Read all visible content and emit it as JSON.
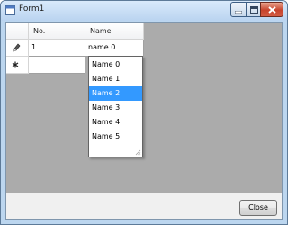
{
  "window": {
    "title": "Form1"
  },
  "grid": {
    "columns": [
      "No.",
      "Name"
    ],
    "rows": [
      {
        "no": "1",
        "name": "name 0",
        "state": "editing"
      },
      {
        "no": "",
        "name": "",
        "state": "new-row"
      }
    ]
  },
  "dropdown": {
    "options": [
      "Name 0",
      "Name 1",
      "Name 2",
      "Name 3",
      "Name 4",
      "Name 5"
    ],
    "selected": "Name 2"
  },
  "footer": {
    "close_label": "Close"
  },
  "icons": {
    "app": "app-window-icon",
    "row_editing": "pencil-icon",
    "row_new": "asterisk-icon",
    "minimize": "minimize-icon",
    "maximize": "maximize-icon",
    "close": "close-icon"
  },
  "colors": {
    "selection": "#3399ff",
    "grid_background": "#ababab"
  }
}
